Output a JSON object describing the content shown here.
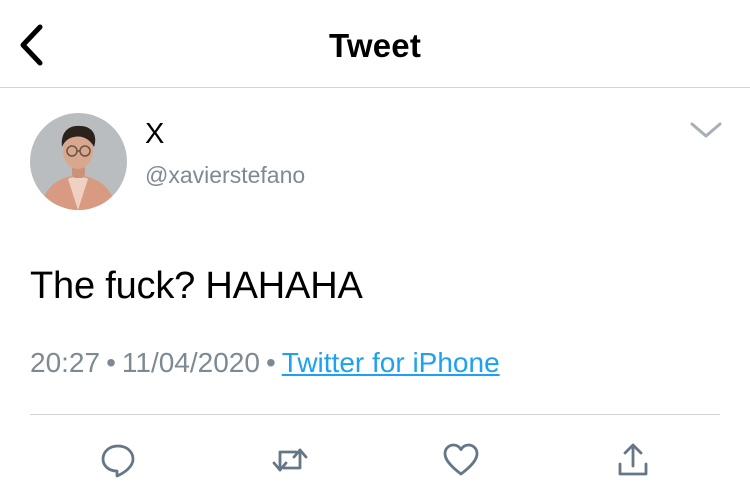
{
  "nav": {
    "title": "Tweet",
    "back_icon": "chevron-left-icon"
  },
  "author": {
    "display_name": "X",
    "handle": "@xavierstefano"
  },
  "tweet": {
    "text": "The fuck? HAHAHA",
    "time": "20:27",
    "separator": "•",
    "date": "11/04/2020",
    "source": "Twitter for iPhone"
  },
  "actions": [
    "reply-icon",
    "retweet-icon",
    "like-icon",
    "share-icon"
  ],
  "colors": {
    "accent": "#1da1f2",
    "muted_text": "#7d8a94",
    "icon": "#657786",
    "divider": "#cfd5da"
  }
}
